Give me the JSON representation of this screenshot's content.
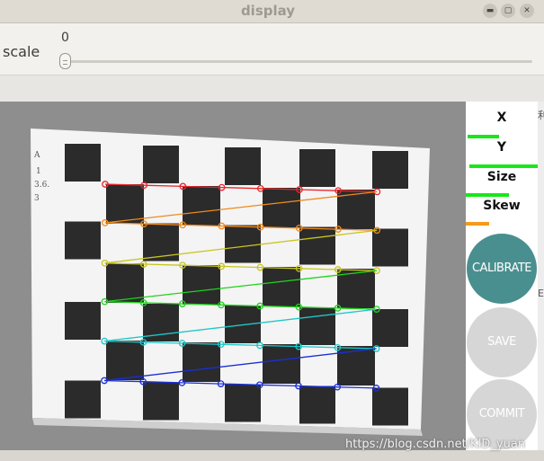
{
  "window": {
    "title": "display",
    "buttons": {
      "minimize": "▬",
      "maximize": "▢",
      "close": "✕"
    }
  },
  "trackbar": {
    "label": "scale",
    "value": "0",
    "position": 0
  },
  "stats": {
    "x_label": "X",
    "y_label": "Y",
    "size_label": "Size",
    "skew_label": "Skew"
  },
  "actions": {
    "calibrate_label": "CALIBRATE",
    "save_label": "SAVE",
    "commit_label": "COMMIT"
  },
  "image": {
    "handwriting": [
      "A",
      "1",
      "3.6.",
      "3"
    ],
    "corner_colors": [
      "#e8262b",
      "#f08a1c",
      "#c8c51c",
      "#20d21c",
      "#1ec8c8",
      "#1a2fd6"
    ],
    "stat_bar_colors": {
      "x": "#19e619",
      "y": "#19e619",
      "size": "#19e619",
      "skew": "#f59a1b"
    }
  },
  "watermark": "https://blog.csdn.net/KID_yuan",
  "edge_glyphs": [
    "利",
    "E"
  ]
}
